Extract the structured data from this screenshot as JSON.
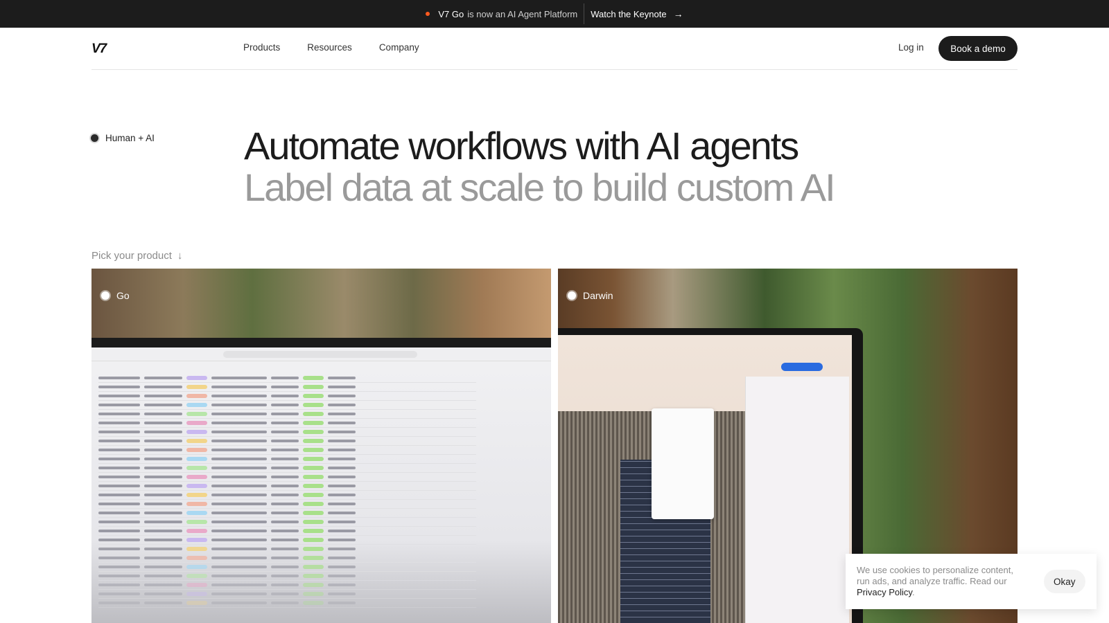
{
  "announcement": {
    "product": "V7 Go",
    "message": "is now an AI Agent Platform",
    "cta": "Watch the Keynote",
    "accent_color": "#ff5a1f"
  },
  "nav": {
    "logo": "V7",
    "links": [
      "Products",
      "Resources",
      "Company"
    ],
    "login": "Log in",
    "demo": "Book a demo"
  },
  "hero": {
    "tag": "Human + AI",
    "headline": "Automate workflows with AI agents",
    "subheadline": "Label data at scale to build custom AI"
  },
  "pick_label": "Pick your product",
  "products": [
    {
      "name": "Go"
    },
    {
      "name": "Darwin"
    }
  ],
  "cookie": {
    "text": "We use cookies to personalize content, run ads, and analyze traffic. Read our",
    "link": "Privacy Policy",
    "suffix": ".",
    "button": "Okay"
  }
}
